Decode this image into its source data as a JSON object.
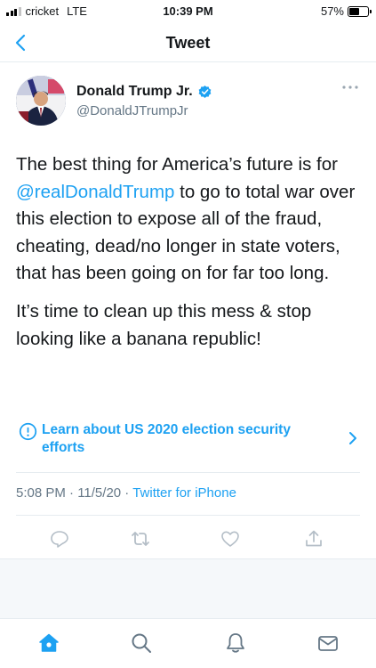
{
  "status_bar": {
    "carrier": "cricket",
    "network": "LTE",
    "time": "10:39 PM",
    "battery_percent": "57%",
    "battery_level": 0.57
  },
  "nav": {
    "back_icon": "chevron-left-icon",
    "title": "Tweet"
  },
  "tweet": {
    "author_name": "Donald Trump Jr.",
    "author_handle": "@DonaldJTrumpJr",
    "verified_icon": "verified-badge-icon",
    "more_icon": "more-dots-icon",
    "body": {
      "line1_prefix": "The best thing for America’s future is for ",
      "mention": "@realDonaldTrump",
      "line1_suffix": " to go to total war over this election to expose all of the fraud, cheating, dead/no longer in state voters, that has been going on for far too long.",
      "paragraph2": "It’s time to clean up this mess & stop looking like a banana republic!"
    },
    "election_label": "Learn about US 2020 election security efforts",
    "timestamp": "5:08 PM · 11/5/20 · ",
    "source": "Twitter for iPhone"
  },
  "actions": [
    "reply-icon",
    "retweet-icon",
    "like-icon",
    "share-icon"
  ],
  "tabbar": [
    "home-icon",
    "search-icon",
    "notifications-icon",
    "messages-icon"
  ],
  "colors": {
    "accent": "#1da1f2",
    "text": "#14171a",
    "secondary": "#657786",
    "divider": "#e6ecf0"
  }
}
